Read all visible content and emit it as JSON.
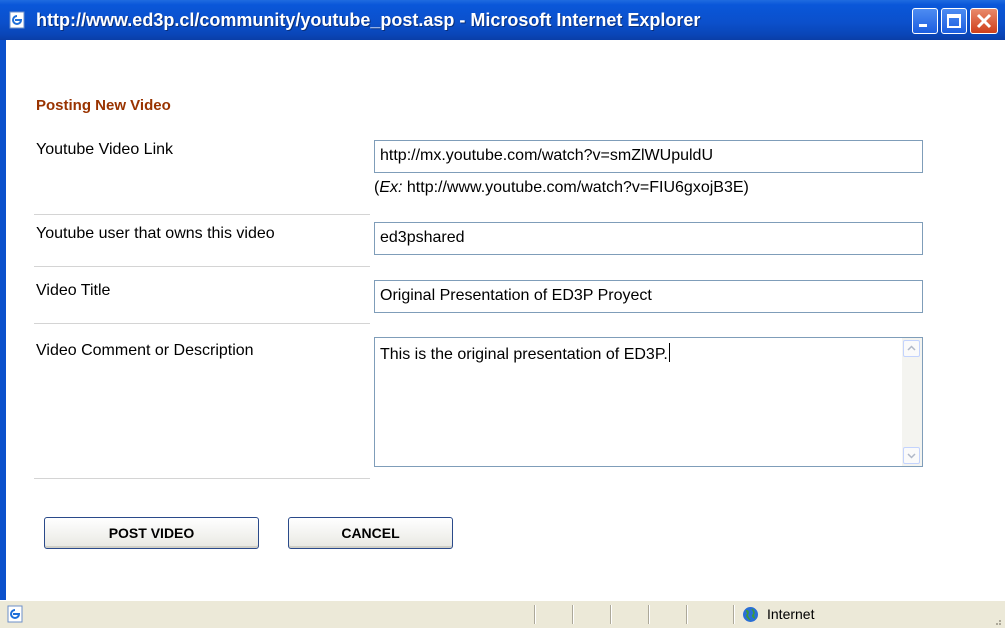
{
  "window": {
    "title": "http://www.ed3p.cl/community/youtube_post.asp - Microsoft Internet Explorer"
  },
  "form": {
    "heading": "Posting New Video",
    "link_label": "Youtube Video Link",
    "link_value": "http://mx.youtube.com/watch?v=smZlWUpuldU",
    "link_example_prefix": "Ex:",
    "link_example_url": " http://www.youtube.com/watch?v=FIU6gxojB3E)",
    "link_example_open": "(",
    "owner_label": "Youtube user that owns this video",
    "owner_value": "ed3pshared",
    "title_label": "Video Title",
    "title_value": "Original Presentation of ED3P Proyect",
    "description_label": "Video Comment or Description",
    "description_value": "This is the original presentation of ED3P."
  },
  "buttons": {
    "post_label": "POST VIDEO",
    "cancel_label": "CANCEL"
  },
  "statusbar": {
    "zone": "Internet"
  },
  "colors": {
    "heading": "#993300",
    "titlebar": "#0b50cc",
    "input_border": "#7f9db9"
  }
}
